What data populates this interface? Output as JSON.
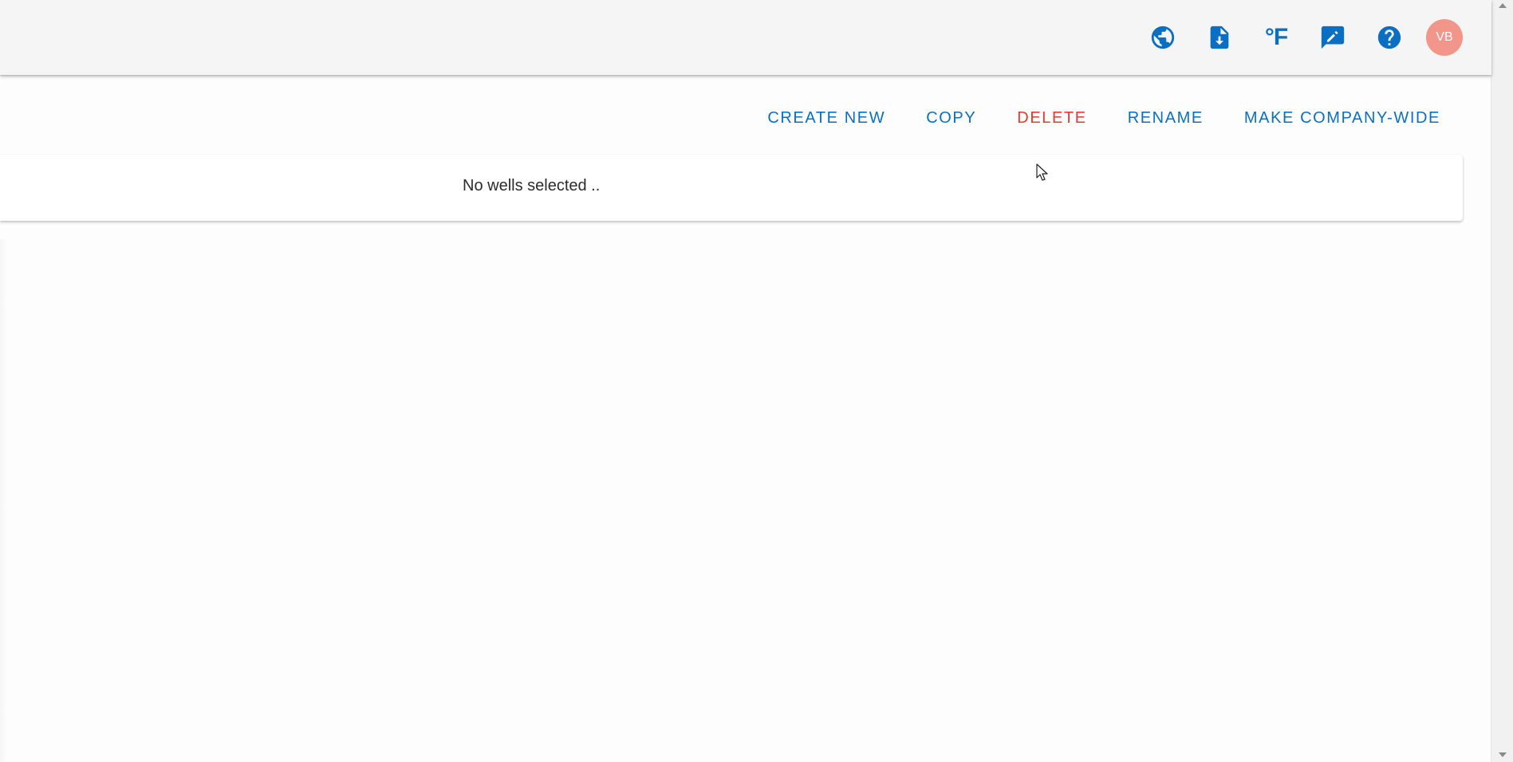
{
  "app_bar": {
    "icons": [
      {
        "name": "globe-icon"
      },
      {
        "name": "file-download-icon"
      },
      {
        "name": "temperature-unit-icon",
        "label": "°F"
      },
      {
        "name": "feedback-edit-icon"
      },
      {
        "name": "help-icon"
      }
    ],
    "avatar": {
      "initials": "VB",
      "color": "#f2958a"
    }
  },
  "toolbar": {
    "create_new": "CREATE NEW",
    "copy": "COPY",
    "delete": "DELETE",
    "rename": "RENAME",
    "make_company_wide": "MAKE COMPANY-WIDE"
  },
  "card": {
    "message": "No wells selected .."
  },
  "colors": {
    "accent": "#0a6fc2",
    "danger": "#e8392b",
    "app_bar_bg": "#f5f5f5"
  }
}
